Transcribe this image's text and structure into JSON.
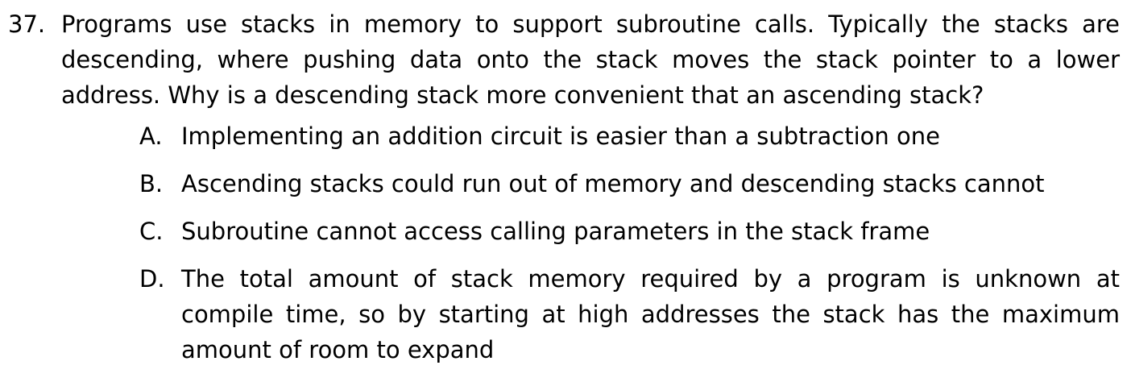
{
  "question": {
    "number": "37.",
    "text": "Programs use stacks in memory to support subroutine calls.  Typically the stacks are descending, where pushing data onto the stack moves the stack pointer to a lower address. Why is a descending stack more convenient that an ascending stack?"
  },
  "options": [
    {
      "letter": "A.",
      "text": "Implementing an addition circuit is easier than a subtraction one"
    },
    {
      "letter": "B.",
      "text": "Ascending stacks could run out of memory and descending stacks cannot"
    },
    {
      "letter": "C.",
      "text": "Subroutine cannot access calling parameters in the stack frame"
    },
    {
      "letter": "D.",
      "text": "The total amount of stack memory required by a program is unknown at compile time, so by starting at high addresses the stack has the maximum amount of room to expand"
    }
  ]
}
